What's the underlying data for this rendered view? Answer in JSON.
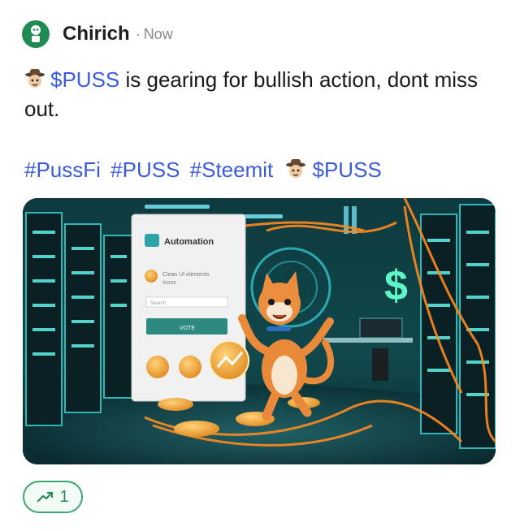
{
  "post": {
    "author": "Chirich",
    "separator": "·",
    "time": "Now",
    "body_ticker": "$PUSS",
    "body_text": " is gearing for bullish action, dont miss out.",
    "hashtags": [
      "#PussFi",
      "#PUSS",
      "#Steemit"
    ],
    "tag_ticker": "$PUSS"
  },
  "image": {
    "panel_title": "Automation",
    "panel_line1": "Clean UI elements",
    "panel_line2": "Icons",
    "panel_input": "Search",
    "panel_button": "VOTE",
    "dollar_sign": "$"
  },
  "reactions": {
    "trend_count": "1"
  },
  "colors": {
    "link": "#3b5bdb",
    "avatar": "#1f8a52",
    "chip_border": "#3aa76d"
  },
  "icons": {
    "avatar": "robot-avatar-icon",
    "emoji": "cowboy-cat-emoji-icon",
    "trend": "trending-up-icon"
  }
}
